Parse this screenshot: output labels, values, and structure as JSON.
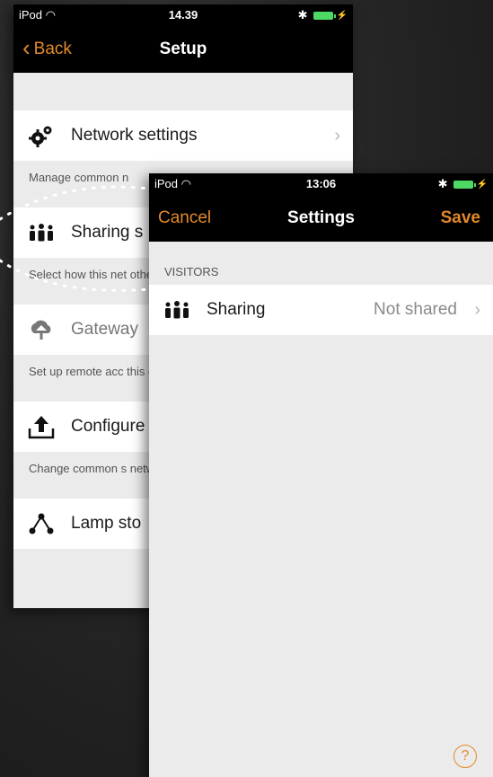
{
  "back_screen": {
    "status": {
      "carrier": "iPod",
      "time": "14.39"
    },
    "nav": {
      "back_label": "Back",
      "title": "Setup"
    },
    "items": [
      {
        "label": "Network settings",
        "icon": "gears-icon",
        "desc": "Manage common n",
        "dim": false
      },
      {
        "label": "Sharing s",
        "icon": "people-icon",
        "desc": "Select how this net other mobile devic",
        "dim": false
      },
      {
        "label": "Gateway",
        "icon": "cloud-upload-icon",
        "desc": "Set up remote acc this device.",
        "dim": true
      },
      {
        "label": "Configure",
        "icon": "upload-icon",
        "desc": "Change common s network.",
        "dim": false
      },
      {
        "label": "Lamp sto",
        "icon": "network-nodes-icon",
        "desc": "",
        "dim": false
      }
    ]
  },
  "front_screen": {
    "status": {
      "carrier": "iPod",
      "time": "13:06"
    },
    "nav": {
      "cancel_label": "Cancel",
      "title": "Settings",
      "save_label": "Save"
    },
    "section_header": "VISITORS",
    "row": {
      "label": "Sharing",
      "value": "Not shared"
    },
    "help_glyph": "?"
  },
  "colors": {
    "accent": "#e2892a",
    "battery": "#4cd964"
  }
}
